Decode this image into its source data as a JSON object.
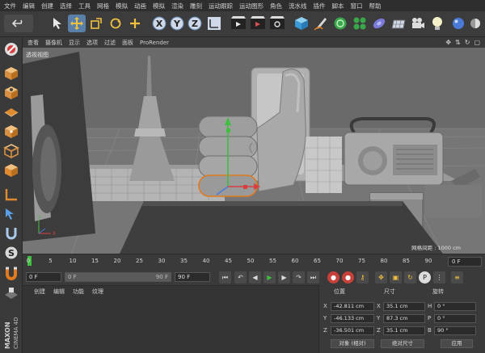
{
  "menu": [
    "文件",
    "编辑",
    "创建",
    "选择",
    "工具",
    "网格",
    "模拟",
    "动画",
    "模拟",
    "渲染",
    "雕刻",
    "运动跟踪",
    "运动图形",
    "角色",
    "流水线",
    "插件",
    "脚本",
    "窗口",
    "帮助"
  ],
  "viewport_menu": [
    "查看",
    "摄像机",
    "显示",
    "选项",
    "过滤",
    "面板",
    "ProRender"
  ],
  "viewport": {
    "label": "透视视图",
    "grid_spacing": "网格间距 : 1000 cm"
  },
  "timeline": {
    "ticks": [
      "0",
      "5",
      "10",
      "15",
      "20",
      "25",
      "30",
      "35",
      "40",
      "45",
      "50",
      "55",
      "60",
      "65",
      "70",
      "75",
      "80",
      "85",
      "90"
    ],
    "current_frame": "0 F"
  },
  "transport": {
    "start": "0 F",
    "min": "0 F",
    "max": "90 F",
    "end": "90 F"
  },
  "object_panel": {
    "menu": [
      "创建",
      "编辑",
      "功能",
      "纹理"
    ]
  },
  "coords": {
    "headers": {
      "position": "位置",
      "size": "尺寸",
      "rotation": "旋转"
    },
    "rows": [
      {
        "axis": "X",
        "pos": "-42.811 cm",
        "size_axis": "X",
        "size": "35.1 cm",
        "rot_axis": "H",
        "rot": "0 °"
      },
      {
        "axis": "Y",
        "pos": "-46.133 cm",
        "size_axis": "Y",
        "size": "87.3 cm",
        "rot_axis": "P",
        "rot": "0 °"
      },
      {
        "axis": "Z",
        "pos": "-36.501 cm",
        "size_axis": "Z",
        "size": "35.1 cm",
        "rot_axis": "B",
        "rot": "90 °"
      }
    ],
    "mode_select": "对象 (相对)",
    "size_select": "绝对尺寸",
    "apply": "应用"
  },
  "logo": {
    "brand": "MAXON",
    "product": "CINEMA 4D"
  },
  "colors": {
    "accent": "#5a7fa8",
    "viewport_bg": "#6e6e6e",
    "selection": "#e07a1f",
    "axis_y": "#3fbf3f",
    "axis_x": "#d84040"
  }
}
